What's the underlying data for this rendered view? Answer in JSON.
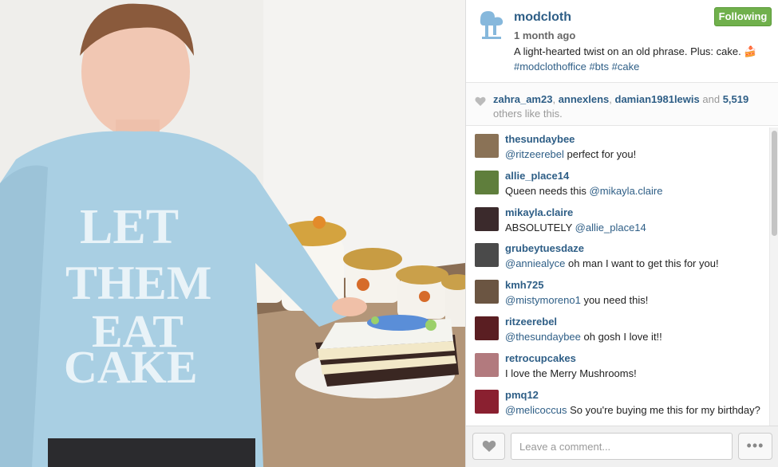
{
  "post": {
    "username": "modcloth",
    "follow_label": "Following",
    "time_ago": "1 month ago",
    "caption_text": "A light-hearted twist on an old phrase. Plus: cake. 🍰",
    "caption_tags": [
      "#modclothoffice",
      "#bts",
      "#cake"
    ],
    "sweater_text": [
      "LET",
      "THEM",
      "EAT",
      "CAKE"
    ]
  },
  "likes": {
    "users": [
      "zahra_am23",
      "annexlens",
      "damian1981lewis"
    ],
    "and_word": "and",
    "count": "5,519",
    "suffix": "others like this."
  },
  "comments": [
    {
      "user": "thesundaybee",
      "mention": "@ritzeerebel",
      "text": " perfect for you!",
      "avatar_color": "#8a7256"
    },
    {
      "user": "allie_place14",
      "mention": "",
      "text": "Queen needs this ",
      "mention_after": "@mikayla.claire",
      "avatar_color": "#5f7e3c"
    },
    {
      "user": "mikayla.claire",
      "mention": "",
      "text": "ABSOLUTELY ",
      "mention_after": "@allie_place14",
      "avatar_color": "#3b2a2c"
    },
    {
      "user": "grubeytuesdaze",
      "mention": "@anniealyce",
      "text": " oh man I want to get this for you!",
      "avatar_color": "#4a4a4a"
    },
    {
      "user": "kmh725",
      "mention": "@mistymoreno1",
      "text": " you need this!",
      "avatar_color": "#6b5542"
    },
    {
      "user": "ritzeerebel",
      "mention": "@thesundaybee",
      "text": " oh gosh I love it!!",
      "avatar_color": "#5a1e22"
    },
    {
      "user": "retrocupcakes",
      "mention": "",
      "text": "I love the Merry Mushrooms!",
      "avatar_color": "#b27a7e"
    },
    {
      "user": "pmq12",
      "mention": "@melicoccus",
      "text": " So you're buying me this for my birthday?",
      "avatar_color": "#8a2030"
    }
  ],
  "footer": {
    "comment_placeholder": "Leave a comment...",
    "more_label": "•••"
  },
  "colors": {
    "link": "#2e5e86",
    "follow_bg": "#70b04c",
    "sweater": "#a9cfe3"
  }
}
